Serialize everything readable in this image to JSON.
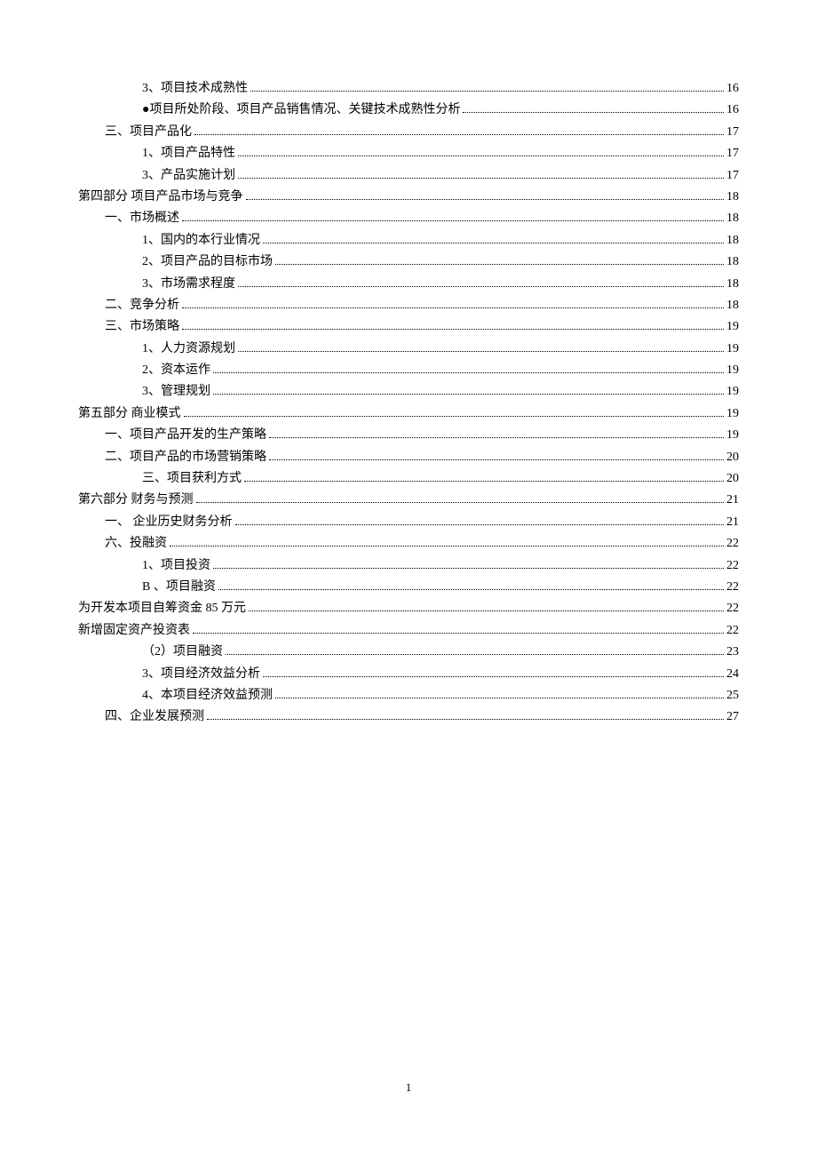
{
  "page_number": "1",
  "toc": [
    {
      "label": "3、项目技术成熟性",
      "page": "16",
      "indent": 2
    },
    {
      "label": "●项目所处阶段、项目产品销售情况、关键技术成熟性分析",
      "page": "16",
      "indent": 2
    },
    {
      "label": "三、项目产品化",
      "page": "17",
      "indent": 1
    },
    {
      "label": "1、项目产品特性",
      "page": "17",
      "indent": 2
    },
    {
      "label": "3、产品实施计划",
      "page": "17",
      "indent": 2
    },
    {
      "label": "第四部分 项目产品市场与竞争",
      "page": "18",
      "indent": 0
    },
    {
      "label": "一、市场概述",
      "page": "18",
      "indent": 1
    },
    {
      "label": "1、国内的本行业情况",
      "page": "18",
      "indent": 2
    },
    {
      "label": "2、项目产品的目标市场",
      "page": "18",
      "indent": 2
    },
    {
      "label": "3、市场需求程度",
      "page": "18",
      "indent": 2
    },
    {
      "label": "二、竞争分析",
      "page": "18",
      "indent": 1
    },
    {
      "label": "三、市场策略",
      "page": "19",
      "indent": 1
    },
    {
      "label": "1、人力资源规划",
      "page": "19",
      "indent": 2
    },
    {
      "label": "2、资本运作",
      "page": "19",
      "indent": 2
    },
    {
      "label": "3、管理规划",
      "page": "19",
      "indent": 2
    },
    {
      "label": "第五部分   商业模式",
      "page": "19",
      "indent": 0
    },
    {
      "label": "一、项目产品开发的生产策略",
      "page": "19",
      "indent": 1
    },
    {
      "label": "二、项目产品的市场营销策略",
      "page": "20",
      "indent": 1
    },
    {
      "label": "三、项目获利方式",
      "page": "20",
      "indent": 2
    },
    {
      "label": "第六部分   财务与预测",
      "page": "21",
      "indent": 0
    },
    {
      "label": "一、   企业历史财务分析",
      "page": "21",
      "indent": 1
    },
    {
      "label": "六、投融资",
      "page": "22",
      "indent": 1
    },
    {
      "label": "1、项目投资",
      "page": "22",
      "indent": 2
    },
    {
      "label": "B 、项目融资",
      "page": "22",
      "indent": 2
    },
    {
      "label": "为开发本项目自筹资金 85 万元",
      "page": "22",
      "indent": 0
    },
    {
      "label": "新增固定资产投资表",
      "page": "22",
      "indent": 0
    },
    {
      "label": "（2）项目融资",
      "page": "23",
      "indent": 2
    },
    {
      "label": "3、项目经济效益分析",
      "page": "24",
      "indent": 2
    },
    {
      "label": "4、本项目经济效益预测",
      "page": "25",
      "indent": 2
    },
    {
      "label": "四、企业发展预测",
      "page": "27",
      "indent": 1
    }
  ]
}
